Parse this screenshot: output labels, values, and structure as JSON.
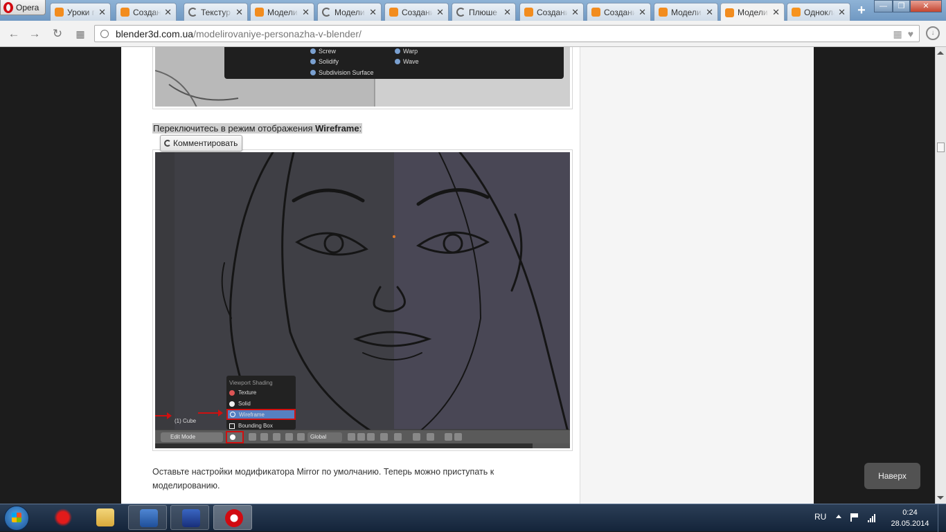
{
  "browser": {
    "menu_label": "Opera",
    "tabs": [
      {
        "label": "Уроки п",
        "icon": "blender-icon"
      },
      {
        "label": "Создани",
        "icon": "blender-icon"
      },
      {
        "label": "Текстур",
        "icon": "loading-icon"
      },
      {
        "label": "Модели",
        "icon": "blender-icon"
      },
      {
        "label": "Модели",
        "icon": "loading-icon"
      },
      {
        "label": "Создани",
        "icon": "blender-icon"
      },
      {
        "label": "Плюше",
        "icon": "loading-icon"
      },
      {
        "label": "Создани",
        "icon": "blender-icon"
      },
      {
        "label": "Создани",
        "icon": "blender-icon"
      },
      {
        "label": "Модели",
        "icon": "blender-icon"
      },
      {
        "label": "Модели",
        "icon": "blender-icon",
        "active": true
      },
      {
        "label": "Одноклас",
        "icon": "odnoklassniki-icon"
      }
    ],
    "close_glyph": "✕",
    "url_host": "blender3d.com.ua",
    "url_path": "/modelirovaniye-personazha-v-blender/"
  },
  "page": {
    "top_menu_items": {
      "screw": "Screw",
      "solidify": "Solidify",
      "subdivision": "Subdivision Surface",
      "warp": "Warp",
      "wave": "Wave"
    },
    "caption_prefix": "Переключитесь в режим отображения ",
    "caption_bold": "Wireframe",
    "caption_suffix": ":",
    "comment_button": "Комментировать",
    "viewport_menu": {
      "header": "Viewport Shading",
      "options": [
        "Texture",
        "Solid",
        "Wireframe",
        "Bounding Box"
      ],
      "selected": "Wireframe"
    },
    "object_label": "(1) Cube",
    "mode_label": "Edit Mode",
    "orientation_label": "Global",
    "body_text": "Оставьте настройки модификатора Mirror по умолчанию. Теперь можно приступать к моделированию.",
    "back_to_top": "Наверх"
  },
  "taskbar": {
    "lang": "RU",
    "time": "0:24",
    "date": "28.05.2014"
  },
  "colors": {
    "accent_red": "#d01010",
    "selection_blue": "#5680c2",
    "opera_red": "#d10a11"
  }
}
